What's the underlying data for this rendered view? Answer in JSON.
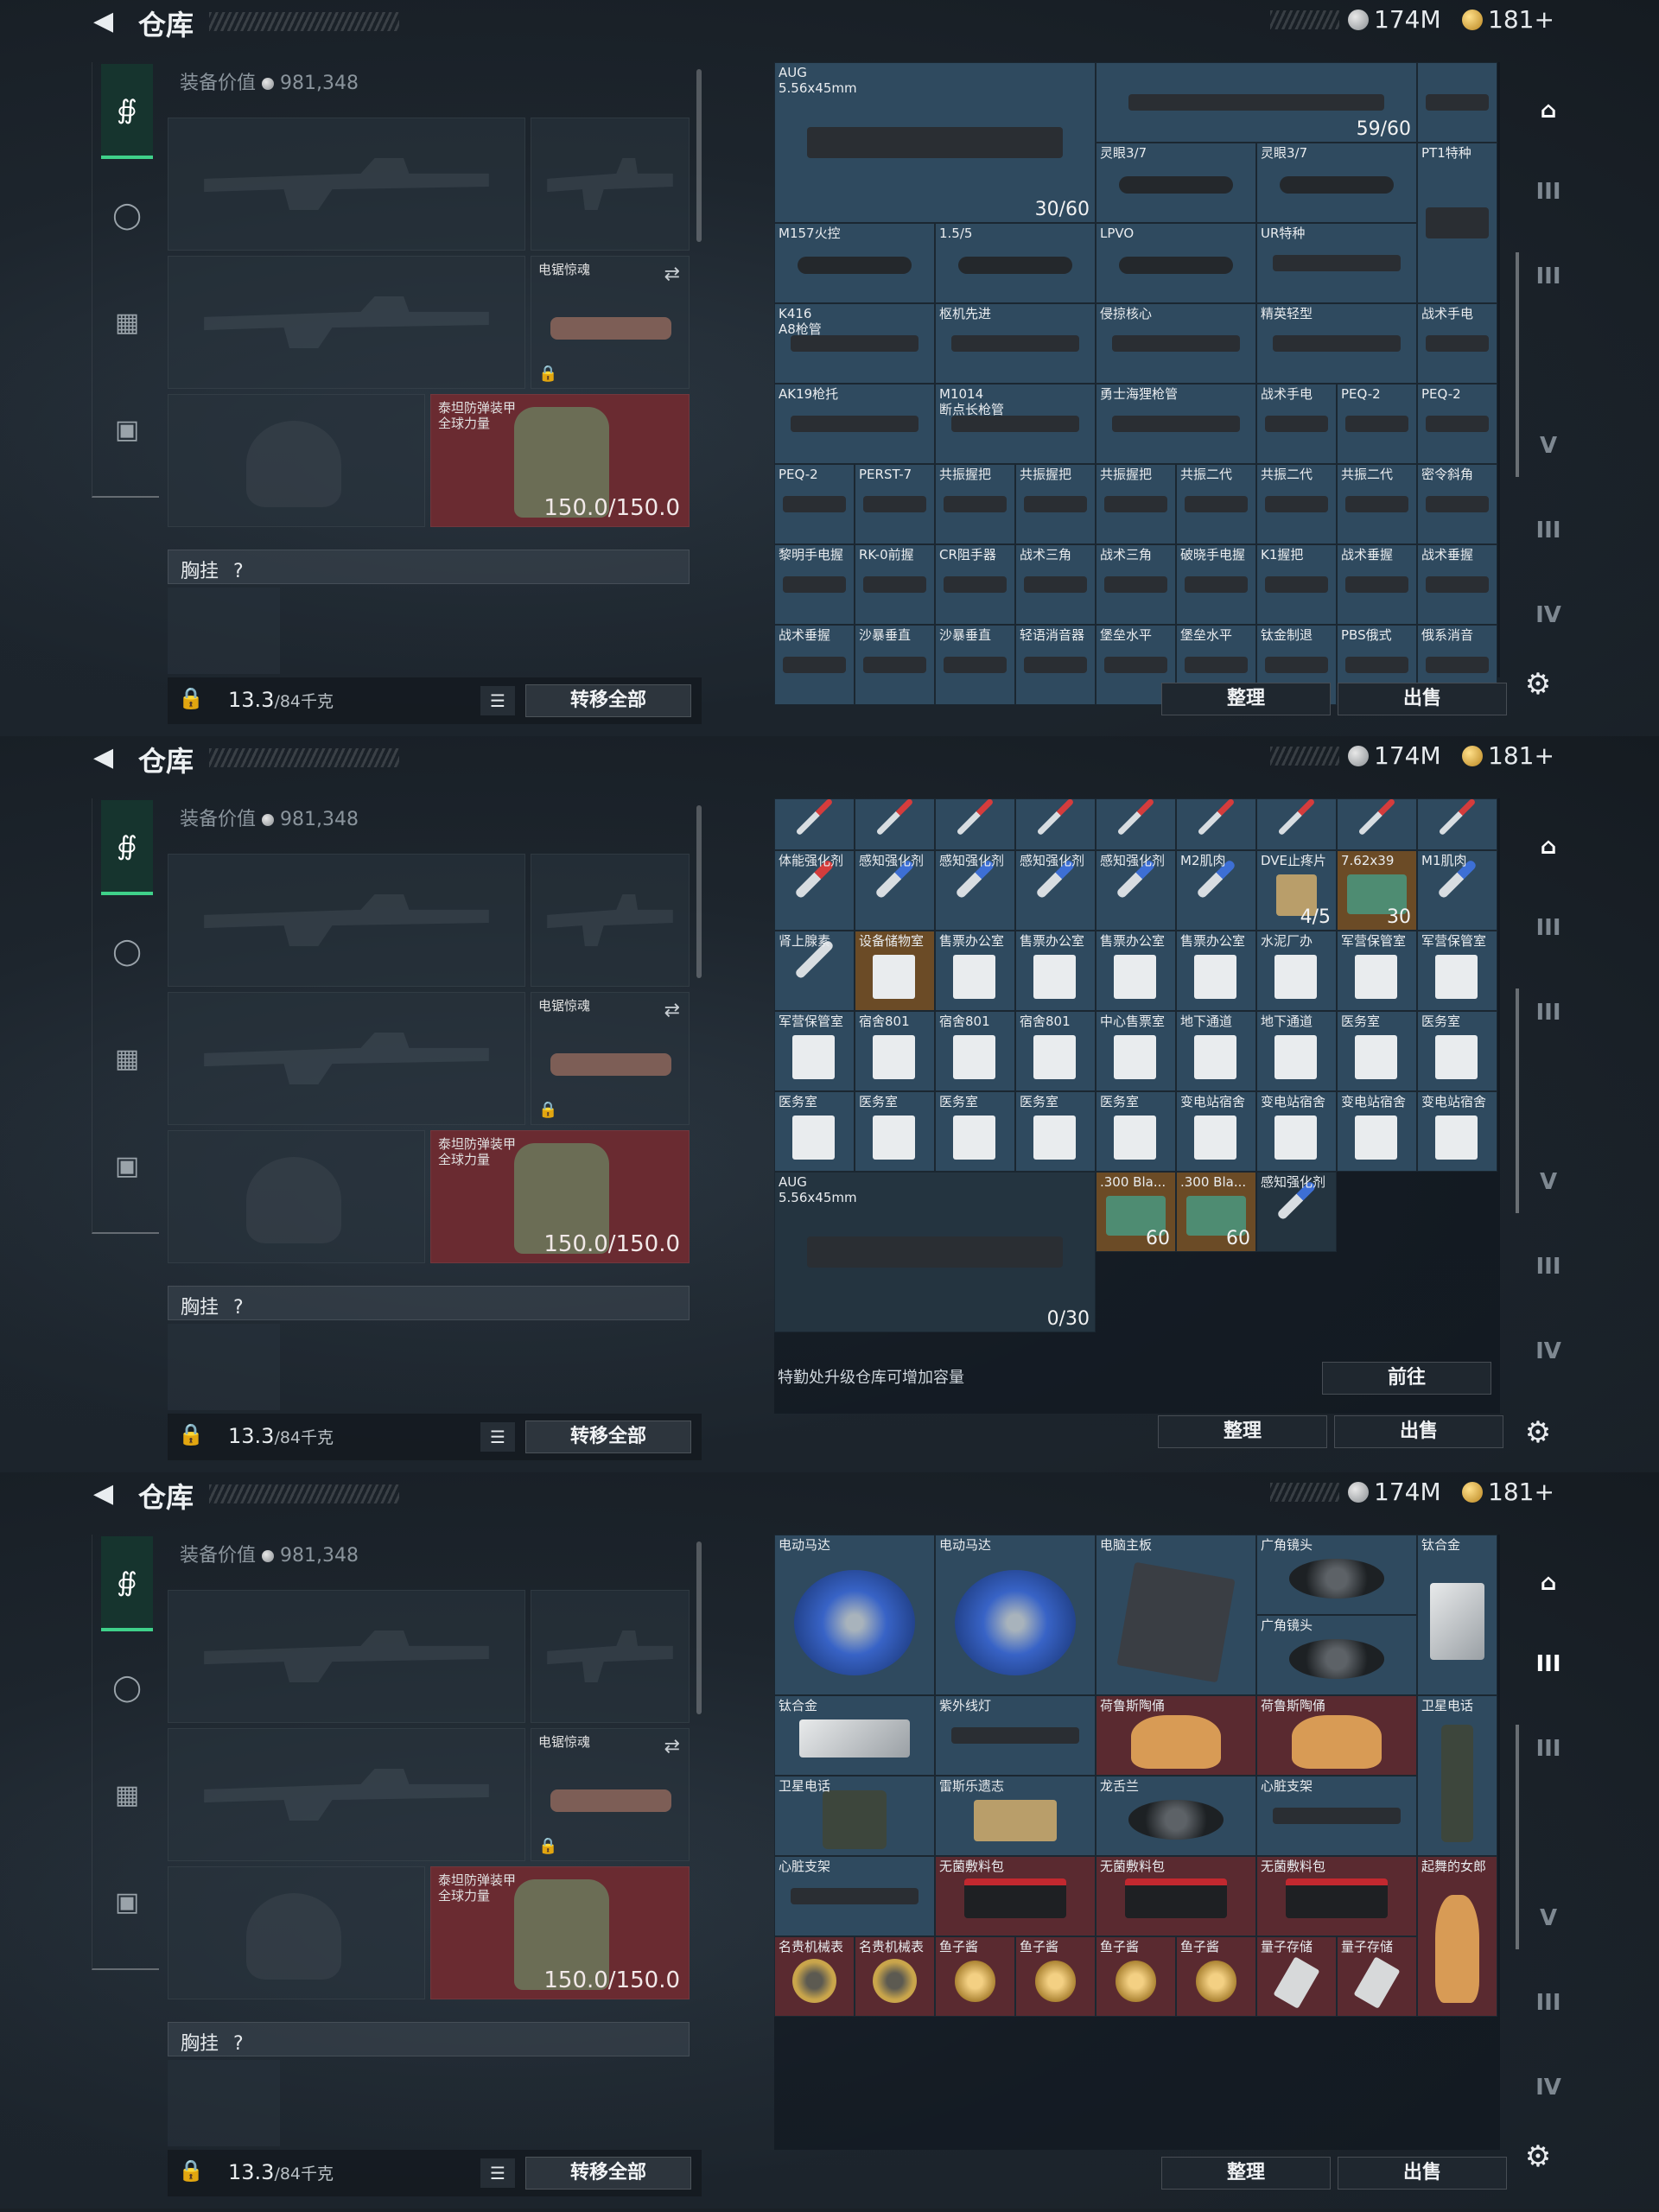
{
  "header": {
    "title": "仓库",
    "silver": "174M",
    "gold": "181+"
  },
  "equipment": {
    "value_label": "装备价值",
    "value": "981,348",
    "melee_name": "电锯惊魂",
    "armor_name": "泰坦防弹装甲\n全球力量",
    "armor_durability": "150.0/150.0",
    "chest_label": "胸挂",
    "chest_help": "?",
    "weight": "13.3",
    "weight_cap": "/84千克",
    "transfer_label": "转移全部"
  },
  "buttons": {
    "sort": "整理",
    "sell": "出售",
    "goto": "前往"
  },
  "hint": "特勤处升级仓库可增加容量",
  "sidebar_tiers": [
    "III",
    "III",
    "",
    "V",
    "III",
    "IV"
  ],
  "screen1": {
    "aug_label": "AUG\n5.56x45mm",
    "aug_count": "30/60",
    "top_count": "59/60",
    "cells": [
      {
        "label": "灵眼3/7",
        "art": "scope",
        "col": 3,
        "row": 1
      },
      {
        "label": "灵眼3/7",
        "art": "scope",
        "col": 4,
        "row": 1
      },
      {
        "label": "PT1特种",
        "art": "rifle",
        "col": 5,
        "row": 1
      },
      {
        "label": "M157火控",
        "art": "scope",
        "col": 0,
        "row": 2
      },
      {
        "label": "1.5/5",
        "art": "scope",
        "col": 1,
        "row": 2
      },
      {
        "label": "LPVO",
        "art": "scope",
        "col": 2,
        "row": 2
      },
      {
        "label": "UR特种",
        "art": "rifle",
        "col": 3,
        "row": 2
      },
      {
        "label": "K416\nA8枪管",
        "art": "rifle",
        "col": 0,
        "row": 3
      },
      {
        "label": "枢机先进",
        "art": "rifle",
        "col": 1,
        "row": 3
      },
      {
        "label": "侵掠核心",
        "art": "rifle",
        "col": 2,
        "row": 3
      },
      {
        "label": "精英轻型",
        "art": "rifle",
        "col": 3,
        "row": 3
      },
      {
        "label": "战术手电",
        "art": "rifle",
        "col": 4,
        "row": 3
      },
      {
        "label": "AK19枪托",
        "art": "rifle",
        "col": 0,
        "row": 4
      },
      {
        "label": "M1014\n断点长枪管",
        "art": "rifle",
        "col": 1,
        "row": 4
      },
      {
        "label": "勇士海狸枪管",
        "art": "rifle",
        "col": 2,
        "row": 4
      },
      {
        "label": "战术手电",
        "art": "rifle",
        "col": 3,
        "row": 4
      },
      {
        "label": "PEQ-2",
        "art": "rifle",
        "col": 4,
        "row": 4
      },
      {
        "label": "PEQ-2",
        "art": "rifle",
        "col": 5,
        "row": 4
      },
      {
        "label": "PEQ-2",
        "art": "rifle",
        "col": 0,
        "row": 5
      },
      {
        "label": "PERST-7",
        "art": "rifle",
        "col": 1,
        "row": 5
      },
      {
        "label": "共振握把",
        "art": "rifle",
        "col": 2,
        "row": 5
      },
      {
        "label": "共振握把",
        "art": "rifle",
        "col": 3,
        "row": 5
      },
      {
        "label": "共振握把",
        "art": "rifle",
        "col": 4,
        "row": 5
      },
      {
        "label": "共振二代",
        "art": "rifle",
        "col": 5,
        "row": 5
      },
      {
        "label": "共振二代",
        "art": "rifle",
        "col": 6,
        "row": 5
      },
      {
        "label": "共振二代",
        "art": "rifle",
        "col": 7,
        "row": 5
      },
      {
        "label": "密令斜角",
        "art": "rifle",
        "col": 8,
        "row": 5
      },
      {
        "label": "黎明手电握",
        "art": "rifle",
        "col": 0,
        "row": 6
      },
      {
        "label": "RK-0前握",
        "art": "rifle",
        "col": 1,
        "row": 6
      },
      {
        "label": "CR阻手器",
        "art": "rifle",
        "col": 2,
        "row": 6
      },
      {
        "label": "战术三角",
        "art": "rifle",
        "col": 3,
        "row": 6
      },
      {
        "label": "战术三角",
        "art": "rifle",
        "col": 4,
        "row": 6
      },
      {
        "label": "破晓手电握",
        "art": "rifle",
        "col": 5,
        "row": 6
      },
      {
        "label": "K1握把",
        "art": "rifle",
        "col": 6,
        "row": 6
      },
      {
        "label": "战术垂握",
        "art": "rifle",
        "col": 7,
        "row": 6
      },
      {
        "label": "战术垂握",
        "art": "rifle",
        "col": 8,
        "row": 6
      },
      {
        "label": "战术垂握",
        "art": "rifle",
        "col": 0,
        "row": 7
      },
      {
        "label": "沙暴垂直",
        "art": "rifle",
        "col": 1,
        "row": 7
      },
      {
        "label": "沙暴垂直",
        "art": "rifle",
        "col": 2,
        "row": 7
      },
      {
        "label": "轻语消音器",
        "art": "rifle",
        "col": 3,
        "row": 7
      },
      {
        "label": "堡垒水平",
        "art": "rifle",
        "col": 4,
        "row": 7
      },
      {
        "label": "堡垒水平",
        "art": "rifle",
        "col": 5,
        "row": 7
      },
      {
        "label": "钛金制退",
        "art": "rifle",
        "col": 6,
        "row": 7
      },
      {
        "label": "PBS俄式",
        "art": "rifle",
        "col": 7,
        "row": 7
      },
      {
        "label": "俄系消音",
        "art": "rifle",
        "col": 8,
        "row": 7
      }
    ]
  },
  "screen2": {
    "rows": [
      [
        {
          "label": "体能强化剂",
          "art": "syringe red"
        },
        {
          "label": "感知强化剂",
          "art": "syringe blue"
        },
        {
          "label": "感知强化剂",
          "art": "syringe blue"
        },
        {
          "label": "感知强化剂",
          "art": "syringe blue"
        },
        {
          "label": "感知强化剂",
          "art": "syringe blue"
        },
        {
          "label": "M2肌肉",
          "art": "syringe blue"
        },
        {
          "label": "DVE止疼片",
          "art": "medkit",
          "count": "4/5"
        },
        {
          "label": "7.62x39",
          "art": "ammo",
          "count": "30",
          "gold": true
        },
        {
          "label": "M1肌肉",
          "art": "syringe blue"
        }
      ],
      [
        {
          "label": "肾上腺素",
          "art": "syringe"
        },
        {
          "label": "设备储物室",
          "art": "key",
          "gold": true
        },
        {
          "label": "售票办公室",
          "art": "key"
        },
        {
          "label": "售票办公室",
          "art": "key"
        },
        {
          "label": "售票办公室",
          "art": "key"
        },
        {
          "label": "售票办公室",
          "art": "key"
        },
        {
          "label": "水泥厂办",
          "art": "key"
        },
        {
          "label": "军营保管室",
          "art": "key"
        },
        {
          "label": "军营保管室",
          "art": "key"
        }
      ],
      [
        {
          "label": "军营保管室",
          "art": "key"
        },
        {
          "label": "宿舍801",
          "art": "key"
        },
        {
          "label": "宿舍801",
          "art": "key"
        },
        {
          "label": "宿舍801",
          "art": "key"
        },
        {
          "label": "中心售票室",
          "art": "key"
        },
        {
          "label": "地下通道",
          "art": "key"
        },
        {
          "label": "地下通道",
          "art": "key"
        },
        {
          "label": "医务室",
          "art": "key"
        },
        {
          "label": "医务室",
          "art": "key"
        }
      ],
      [
        {
          "label": "医务室",
          "art": "key"
        },
        {
          "label": "医务室",
          "art": "key"
        },
        {
          "label": "医务室",
          "art": "key"
        },
        {
          "label": "医务室",
          "art": "key"
        },
        {
          "label": "医务室",
          "art": "key"
        },
        {
          "label": "变电站宿舍",
          "art": "key"
        },
        {
          "label": "变电站宿舍",
          "art": "key"
        },
        {
          "label": "变电站宿舍",
          "art": "key"
        },
        {
          "label": "变电站宿舍",
          "art": "key"
        }
      ]
    ],
    "aug_label": "AUG\n5.56x45mm",
    "aug_count": "0/30",
    "ammo1_label": ".300 Bla...",
    "ammo1_count": "60",
    "ammo2_label": ".300 Bla...",
    "ammo2_count": "60",
    "booster_label": "感知强化剂"
  },
  "screen3": {
    "big": [
      {
        "label": "电动马达",
        "art": "motor",
        "col": 0,
        "row": 0,
        "w": 1,
        "h": 2
      },
      {
        "label": "电动马达",
        "art": "motor",
        "col": 1,
        "row": 0,
        "w": 1,
        "h": 2
      },
      {
        "label": "电脑主板",
        "art": "board",
        "col": 2,
        "row": 0,
        "w": 1,
        "h": 2
      },
      {
        "label": "广角镜头",
        "art": "lens",
        "col": 3,
        "row": 0,
        "w": 1,
        "h": 1
      },
      {
        "label": "广角镜头",
        "art": "lens",
        "col": 3,
        "row": 1,
        "w": 1,
        "h": 1
      },
      {
        "label": "钛合金",
        "art": "ingot",
        "col": 4,
        "row": 0,
        "w": 1,
        "h": 2
      },
      {
        "label": "钛合金",
        "art": "ingot",
        "col": 0,
        "row": 2,
        "w": 1,
        "h": 1
      },
      {
        "label": "紫外线灯",
        "art": "rifle",
        "col": 1,
        "row": 2,
        "w": 1,
        "h": 1
      },
      {
        "label": "荷鲁斯陶俑",
        "art": "figure",
        "col": 2,
        "row": 2,
        "w": 1,
        "h": 1,
        "red": true
      },
      {
        "label": "荷鲁斯陶俑",
        "art": "figure",
        "col": 3,
        "row": 2,
        "w": 1,
        "h": 1,
        "red": true
      },
      {
        "label": "卫星电话",
        "art": "phone",
        "col": 4,
        "row": 2,
        "w": 1,
        "h": 2
      },
      {
        "label": "卫星电话",
        "art": "phone",
        "col": 0,
        "row": 3,
        "w": 1,
        "h": 1
      },
      {
        "label": "雷斯乐遗志",
        "art": "medkit",
        "col": 1,
        "row": 3,
        "w": 1,
        "h": 1
      },
      {
        "label": "龙舌兰",
        "art": "lens",
        "col": 2,
        "row": 3,
        "w": 1,
        "h": 1
      },
      {
        "label": "心脏支架",
        "art": "rifle",
        "col": 3,
        "row": 3,
        "w": 1,
        "h": 1
      },
      {
        "label": "心脏支架",
        "art": "rifle",
        "col": 0,
        "row": 4,
        "w": 1,
        "h": 1
      },
      {
        "label": "无菌敷料包",
        "art": "package",
        "col": 1,
        "row": 4,
        "w": 1,
        "h": 1,
        "red": true
      },
      {
        "label": "无菌敷料包",
        "art": "package",
        "col": 2,
        "row": 4,
        "w": 1,
        "h": 1,
        "red": true
      },
      {
        "label": "无菌敷料包",
        "art": "package",
        "col": 3,
        "row": 4,
        "w": 1,
        "h": 1,
        "red": true
      },
      {
        "label": "起舞的女郎",
        "art": "figure",
        "col": 4,
        "row": 4,
        "w": 1,
        "h": 2,
        "red": true
      }
    ],
    "small": [
      {
        "label": "名贵机械表",
        "art": "watch",
        "red": true
      },
      {
        "label": "名贵机械表",
        "art": "watch",
        "red": true
      },
      {
        "label": "鱼子酱",
        "art": "egg",
        "red": true
      },
      {
        "label": "鱼子酱",
        "art": "egg",
        "red": true
      },
      {
        "label": "鱼子酱",
        "art": "egg",
        "red": true
      },
      {
        "label": "鱼子酱",
        "art": "egg",
        "red": true
      },
      {
        "label": "量子存储",
        "art": "usb",
        "red": true
      },
      {
        "label": "量子存储",
        "art": "usb",
        "red": true
      }
    ]
  }
}
